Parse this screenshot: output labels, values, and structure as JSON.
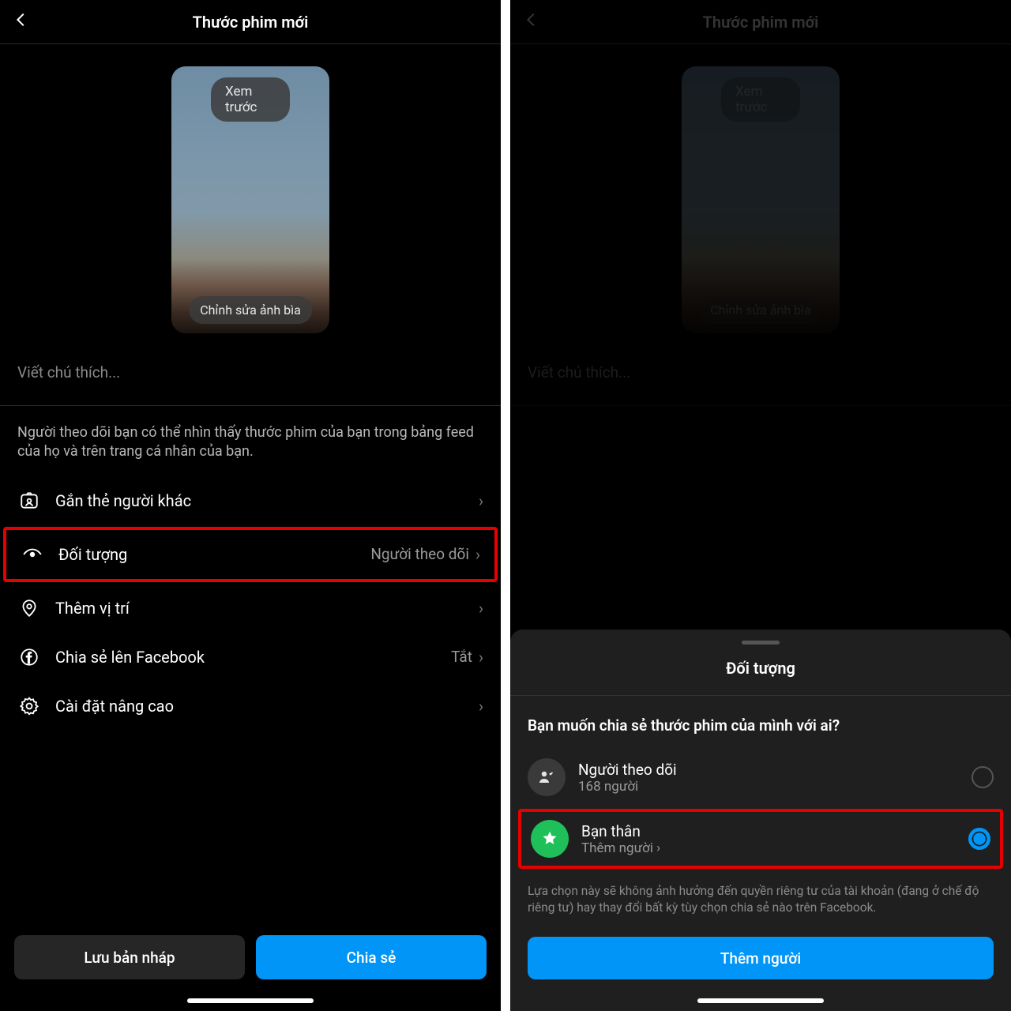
{
  "left": {
    "title": "Thước phim mới",
    "preview_label": "Xem trước",
    "edit_cover_label": "Chỉnh sửa ảnh bìa",
    "caption_placeholder": "Viết chú thích...",
    "info": "Người theo dõi bạn có thể nhìn thấy thước phim của bạn trong bảng feed của họ và trên trang cá nhân của bạn.",
    "rows": {
      "tag": "Gắn thẻ người khác",
      "audience_label": "Đối tượng",
      "audience_value": "Người theo dõi",
      "location": "Thêm vị trí",
      "facebook_label": "Chia sẻ lên Facebook",
      "facebook_value": "Tắt",
      "advanced": "Cài đặt nâng cao"
    },
    "draft_button": "Lưu bản nháp",
    "share_button": "Chia sẻ"
  },
  "right": {
    "title": "Thước phim mới",
    "preview_label": "Xem trước",
    "edit_cover_label": "Chỉnh sửa ảnh bìa",
    "caption_placeholder": "Viết chú thích...",
    "sheet": {
      "title": "Đối tượng",
      "question": "Bạn muốn chia sẻ thước phim của mình với ai?",
      "followers_title": "Người theo dõi",
      "followers_sub": "168 người",
      "close_friends_title": "Bạn thân",
      "close_friends_sub": "Thêm người",
      "info": "Lựa chọn này sẽ không ảnh hưởng đến quyền riêng tư của tài khoản (đang ở chế độ riêng tư) hay thay đổi bất kỳ tùy chọn chia sẻ nào trên Facebook.",
      "add_button": "Thêm người"
    }
  }
}
